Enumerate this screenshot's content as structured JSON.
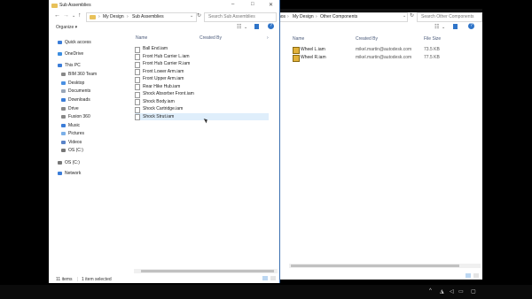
{
  "left_window": {
    "title": "Sub Assemblies",
    "address": {
      "root": "My Design",
      "current": "Sub Assemblies"
    },
    "search_placeholder": "Search Sub Assemblies",
    "toolbar": {
      "organize": "Organize ▾"
    },
    "columns": {
      "name": "Name",
      "created_by": "Created By"
    },
    "nav": [
      {
        "label": "Quick access",
        "icon": "star-icon"
      },
      {
        "label": "OneDrive",
        "icon": "cloud-icon"
      },
      {
        "label": "This PC",
        "icon": "pc-icon"
      },
      {
        "label": "BIM 360 Team",
        "icon": "drive-icon"
      },
      {
        "label": "Desktop",
        "icon": "desktop-icon"
      },
      {
        "label": "Documents",
        "icon": "documents-icon"
      },
      {
        "label": "Downloads",
        "icon": "downloads-icon"
      },
      {
        "label": "Drive",
        "icon": "drive-icon"
      },
      {
        "label": "Fusion 360",
        "icon": "drive-icon"
      },
      {
        "label": "Music",
        "icon": "music-icon"
      },
      {
        "label": "Pictures",
        "icon": "pictures-icon"
      },
      {
        "label": "Videos",
        "icon": "videos-icon"
      },
      {
        "label": "OS (C:)",
        "icon": "disk-icon"
      },
      {
        "label": "OS (C:)",
        "icon": "disk-icon"
      },
      {
        "label": "Network",
        "icon": "network-icon"
      }
    ],
    "files": [
      "Ball End.iam",
      "Front Hub Carrier L.iam",
      "Front Hub Carrier R.iam",
      "Front Lower Arm.iam",
      "Front Upper Arm.iam",
      "Rear Hike Hub.iam",
      "Shock Absorber Front.iam",
      "Shock Body.iam",
      "Shock Cartridge.iam",
      "Shock Strut.iam"
    ],
    "selected_index": 9,
    "status": {
      "count": "11 items",
      "selection": "1 item selected"
    }
  },
  "right_window": {
    "address": {
      "prefix": "nos",
      "root": "My Design",
      "current": "Other Components"
    },
    "search_placeholder": "Search Other Components",
    "columns": {
      "name": "Name",
      "created_by": "Created By",
      "size": "File Size"
    },
    "files": [
      {
        "name": "Wheel L.iam",
        "created_by": "mikel.martin@autodesk.com",
        "size": "73.5 KB"
      },
      {
        "name": "Wheel R.iam",
        "created_by": "mikel.martin@autodesk.com",
        "size": "77.5 KB"
      }
    ]
  },
  "colors": {
    "accent": "#3a6fb0",
    "selection": "#dfeefb",
    "folder": "#e8c15a"
  }
}
